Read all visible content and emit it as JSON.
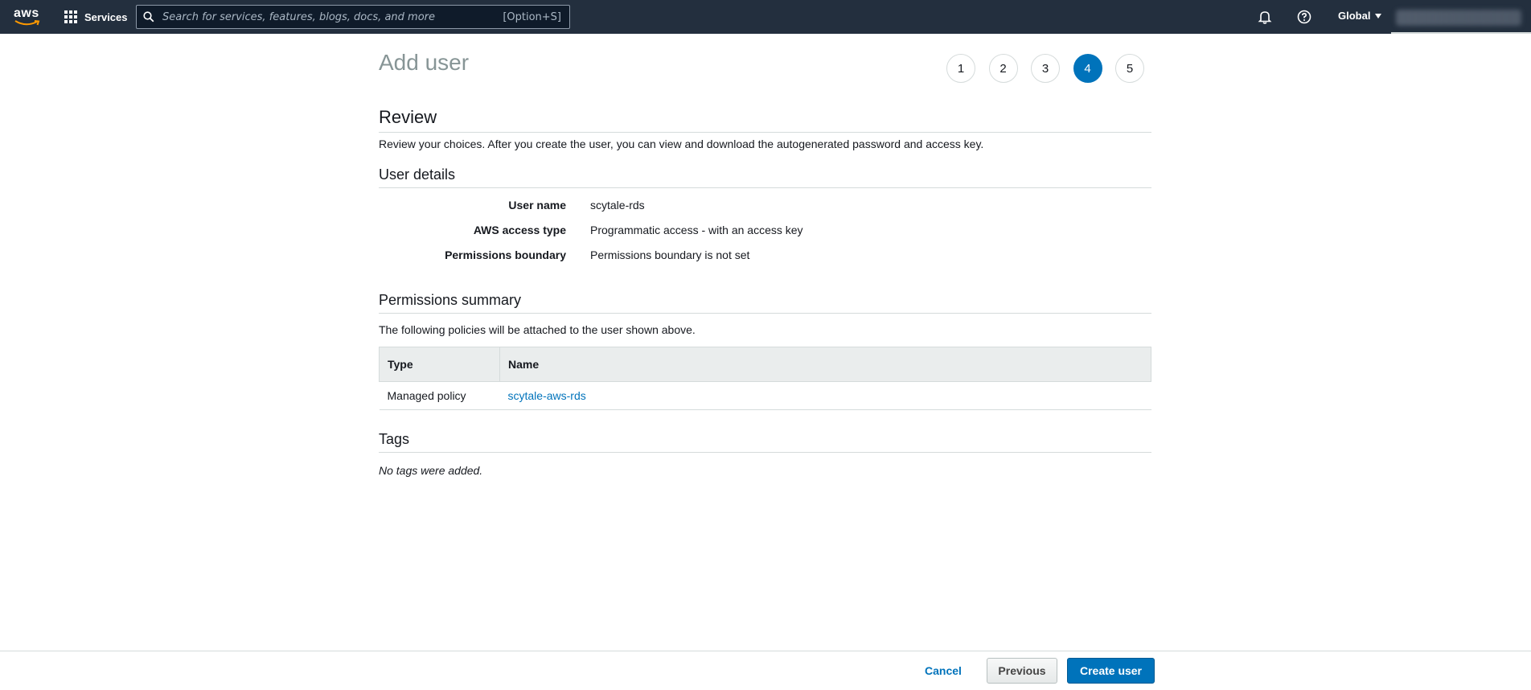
{
  "nav": {
    "logo_text": "aws",
    "services_label": "Services",
    "search_placeholder": "Search for services, features, blogs, docs, and more",
    "search_shortcut": "[Option+S]",
    "region_label": "Global"
  },
  "page": {
    "title": "Add user",
    "steps": [
      "1",
      "2",
      "3",
      "4",
      "5"
    ],
    "active_step": 4
  },
  "review": {
    "heading": "Review",
    "description": "Review your choices. After you create the user, you can view and download the autogenerated password and access key."
  },
  "user_details": {
    "heading": "User details",
    "rows": [
      {
        "label": "User name",
        "value": "scytale-rds"
      },
      {
        "label": "AWS access type",
        "value": "Programmatic access - with an access key"
      },
      {
        "label": "Permissions boundary",
        "value": "Permissions boundary is not set"
      }
    ]
  },
  "permissions": {
    "heading": "Permissions summary",
    "description": "The following policies will be attached to the user shown above.",
    "columns": [
      "Type",
      "Name"
    ],
    "rows": [
      {
        "type": "Managed policy",
        "name": "scytale-aws-rds"
      }
    ]
  },
  "tags": {
    "heading": "Tags",
    "empty_text": "No tags were added."
  },
  "footer": {
    "cancel_label": "Cancel",
    "previous_label": "Previous",
    "create_label": "Create user"
  },
  "colors": {
    "nav_bg": "#232f3e",
    "accent": "#0073bb",
    "aws_orange": "#ff9900"
  }
}
